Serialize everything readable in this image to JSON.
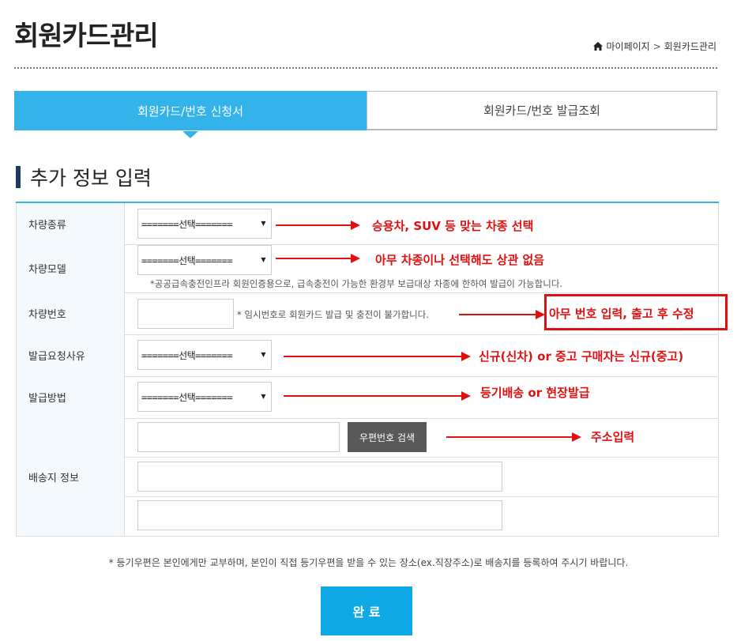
{
  "page": {
    "title": "회원카드관리",
    "breadcrumb": [
      "마이페이지",
      "회원카드관리"
    ]
  },
  "tabs": [
    {
      "label": "회원카드/번호 신청서",
      "active": true
    },
    {
      "label": "회원카드/번호 발급조회",
      "active": false
    }
  ],
  "section": {
    "title": "추가 정보 입력"
  },
  "form": {
    "vehicle_type": {
      "label": "차량종류",
      "value": "=======선택======="
    },
    "vehicle_model": {
      "label": "차량모델",
      "value": "=======선택=======",
      "note": "*공공급속충전인프라 회원인증용으로, 급속충전이 가능한 환경부 보급대상 차종에 한하여 발급이 가능합니다."
    },
    "vehicle_number": {
      "label": "차량번호",
      "value": "",
      "note": "* 임시번호로 회원카드 발급 및 충전이 불가합니다."
    },
    "issue_reason": {
      "label": "발급요청사유",
      "value": "=======선택======="
    },
    "issue_method": {
      "label": "발급방법",
      "value": "=======선택======="
    },
    "shipping": {
      "label": "배송지 정보",
      "zip_button": "우편번호 검색"
    }
  },
  "annotations": {
    "vehicle_type": "승용차, SUV 등 맞는 차종 선택",
    "vehicle_model": "아무 차종이나 선택해도 상관 없음",
    "vehicle_number": "아무 번호 입력, 출고 후 수정",
    "issue_reason": "신규(신차) or 중고 구매자는 신규(중고)",
    "issue_method": "등기배송 or 현장발급",
    "zip": "주소입력"
  },
  "footnote": "* 등기우편은 본인에게만 교부하며, 본인이 직접 등기우편을 받을 수 있는 장소(ex.직장주소)로 배송지를 등록하여 주시기 바랍니다.",
  "submit_label": "완 료",
  "colors": {
    "accent": "#33b3ea",
    "annotation": "#e01010",
    "button_dark": "#595959"
  }
}
